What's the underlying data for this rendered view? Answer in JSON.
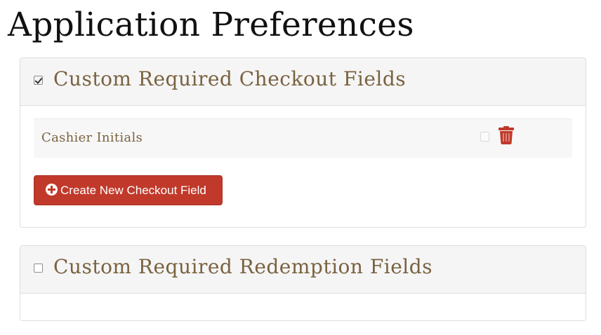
{
  "page": {
    "title": "Application Preferences"
  },
  "panels": [
    {
      "title": "Custom Required Checkout Fields",
      "checked": true,
      "fields": [
        {
          "label": "Cashier Initials",
          "checked": false,
          "action_icon": "trash-icon"
        }
      ],
      "create_button": {
        "icon": "plus-circle-icon",
        "label": "Create New Checkout Field"
      }
    },
    {
      "title": "Custom Required Redemption Fields",
      "checked": false,
      "fields": []
    }
  ],
  "colors": {
    "accent": "#c0392b",
    "heading_text": "#7a6240",
    "panel_heading_bg": "#f5f5f5",
    "border": "#dddddd"
  }
}
